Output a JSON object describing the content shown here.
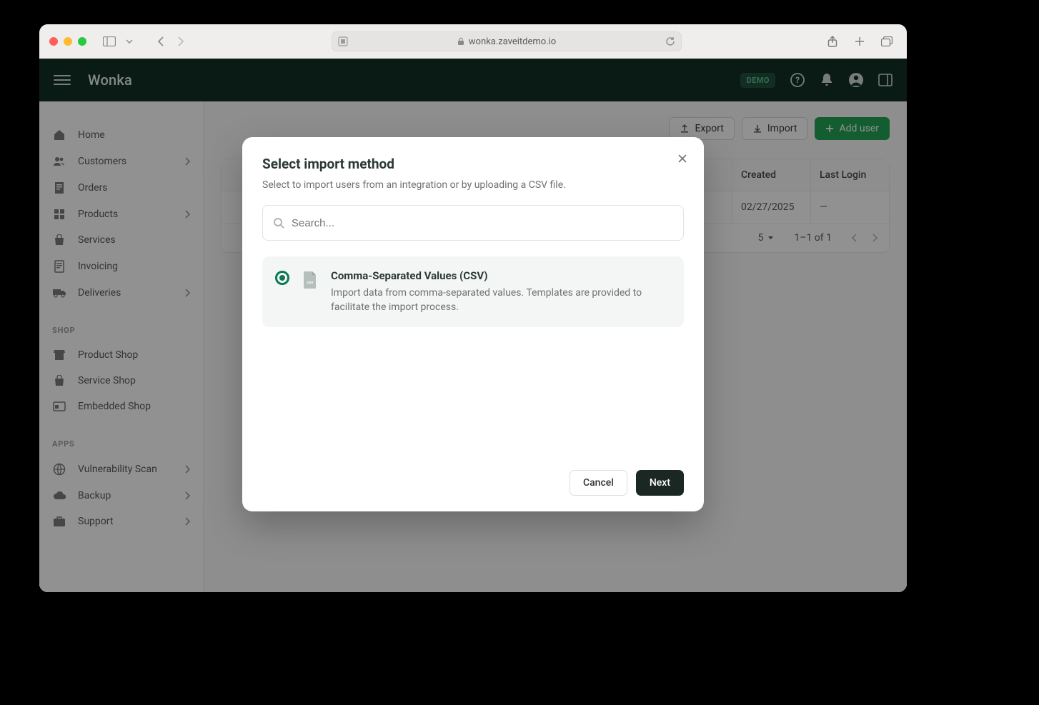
{
  "browser": {
    "url": "wonka.zaveitdemo.io"
  },
  "topbar": {
    "app_title": "Wonka",
    "demo_badge": "DEMO"
  },
  "sidebar": {
    "main": [
      {
        "label": "Home",
        "icon": "home",
        "expandable": false
      },
      {
        "label": "Customers",
        "icon": "people",
        "expandable": true
      },
      {
        "label": "Orders",
        "icon": "receipt",
        "expandable": false
      },
      {
        "label": "Products",
        "icon": "category",
        "expandable": true
      },
      {
        "label": "Services",
        "icon": "bag",
        "expandable": false
      },
      {
        "label": "Invoicing",
        "icon": "invoice",
        "expandable": false
      },
      {
        "label": "Deliveries",
        "icon": "truck",
        "expandable": true
      }
    ],
    "section_shop": "SHOP",
    "shop": [
      {
        "label": "Product Shop",
        "icon": "store"
      },
      {
        "label": "Service Shop",
        "icon": "bag"
      },
      {
        "label": "Embedded Shop",
        "icon": "embed"
      }
    ],
    "section_apps": "APPS",
    "apps": [
      {
        "label": "Vulnerability Scan",
        "icon": "globe",
        "expandable": true
      },
      {
        "label": "Backup",
        "icon": "cloud",
        "expandable": true
      },
      {
        "label": "Support",
        "icon": "support",
        "expandable": true
      }
    ]
  },
  "actions": {
    "export": "Export",
    "import": "Import",
    "add_user": "Add user"
  },
  "table": {
    "headers": {
      "created": "Created",
      "last_login": "Last Login"
    },
    "rows": [
      {
        "created": "02/27/2025",
        "last_login": "—"
      }
    ],
    "page_size": "5",
    "page_info": "1–1 of 1"
  },
  "modal": {
    "title": "Select import method",
    "subtitle": "Select to import users from an integration or by uploading a CSV file.",
    "search_placeholder": "Search...",
    "options": [
      {
        "title": "Comma-Separated Values (CSV)",
        "desc": "Import data from comma-separated values. Templates are provided to facilitate the import process.",
        "selected": true
      }
    ],
    "cancel": "Cancel",
    "next": "Next"
  }
}
